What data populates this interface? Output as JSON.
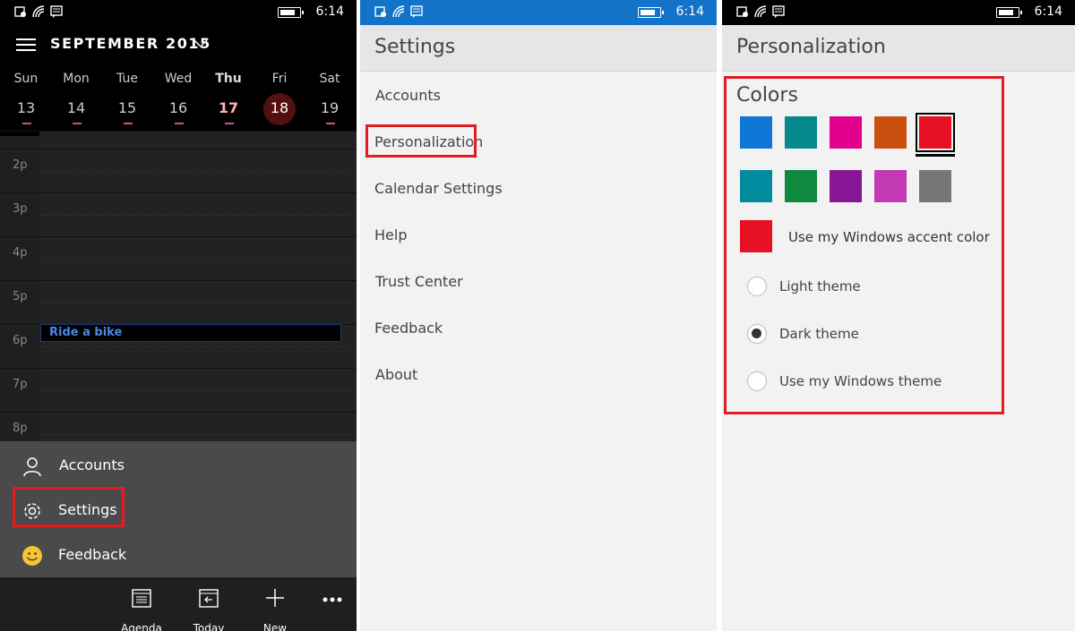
{
  "status": {
    "time": "6:14"
  },
  "calendar": {
    "month": "SEPTEMBER 2015",
    "days": [
      {
        "name": "Sun",
        "date": "13"
      },
      {
        "name": "Mon",
        "date": "14"
      },
      {
        "name": "Tue",
        "date": "15"
      },
      {
        "name": "Wed",
        "date": "16"
      },
      {
        "name": "Thu",
        "date": "17"
      },
      {
        "name": "Fri",
        "date": "18"
      },
      {
        "name": "Sat",
        "date": "19"
      }
    ],
    "hours": [
      "2p",
      "3p",
      "4p",
      "5p",
      "6p",
      "7p",
      "8p"
    ],
    "event": "Ride a bike",
    "menu": {
      "accounts": "Accounts",
      "settings": "Settings",
      "feedback": "Feedback"
    },
    "appbar": {
      "agenda": "Agenda",
      "today": "Today",
      "new": "New"
    }
  },
  "settings": {
    "title": "Settings",
    "items": [
      "Accounts",
      "Personalization",
      "Calendar Settings",
      "Help",
      "Trust Center",
      "Feedback",
      "About"
    ]
  },
  "personalization": {
    "title": "Personalization",
    "colors_heading": "Colors",
    "swatches": [
      "#0f78d7",
      "#05898c",
      "#e3008c",
      "#ca5010",
      "#e81123",
      "#028a9f",
      "#0f893e",
      "#881798",
      "#c239b3",
      "#767676"
    ],
    "selected_swatch": "#e81123",
    "accent_label": "Use my Windows accent color",
    "accent_color": "#e81123",
    "themes": [
      "Light theme",
      "Dark theme",
      "Use my Windows theme"
    ],
    "selected_theme": "Dark theme"
  },
  "highlight_color": "#e31b23"
}
